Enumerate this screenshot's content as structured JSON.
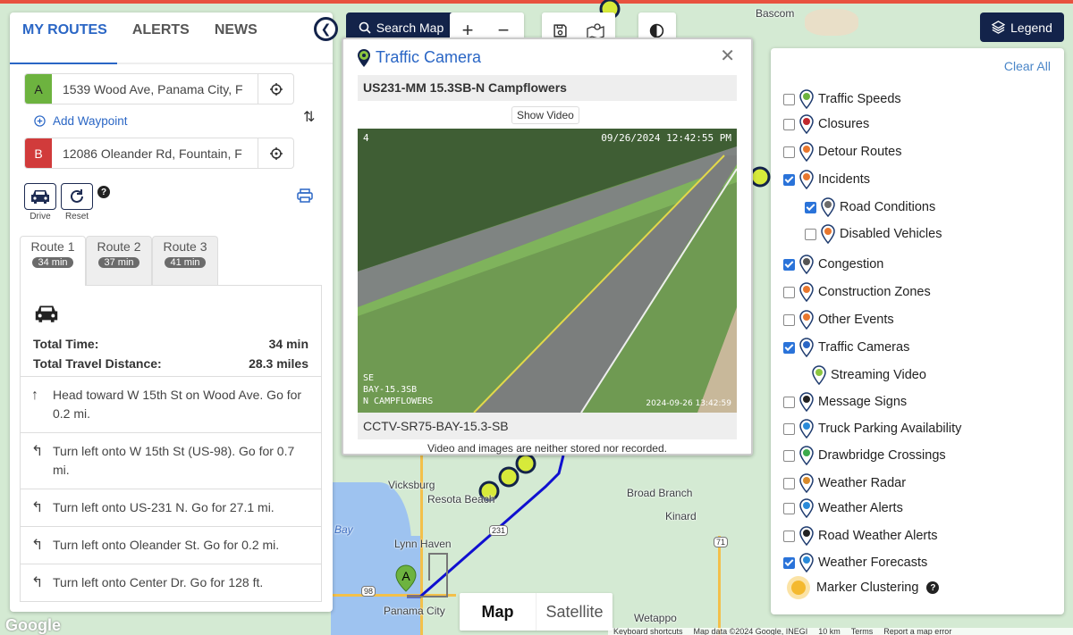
{
  "left_panel": {
    "tabs": [
      {
        "label": "MY ROUTES",
        "active": true
      },
      {
        "label": "ALERTS",
        "active": false
      },
      {
        "label": "NEWS",
        "active": false
      }
    ],
    "origin": {
      "badge": "A",
      "value": "1539 Wood Ave, Panama City, F",
      "color": "#6db33f"
    },
    "destination": {
      "badge": "B",
      "value": "12086 Oleander Rd, Fountain, F",
      "color": "#d13b3b"
    },
    "add_waypoint": "Add Waypoint",
    "drive_label": "Drive",
    "reset_label": "Reset",
    "help": "?",
    "route_tabs": [
      {
        "label": "Route 1",
        "time": "34 min",
        "active": true
      },
      {
        "label": "Route 2",
        "time": "37 min",
        "active": false
      },
      {
        "label": "Route 3",
        "time": "41 min",
        "active": false
      }
    ],
    "summary": {
      "total_time_label": "Total Time:",
      "total_time": "34 min",
      "distance_label": "Total Travel Distance:",
      "distance": "28.3 miles"
    },
    "steps": [
      {
        "icon": "arrow-up",
        "text": "Head toward W 15th St on Wood Ave. Go for 0.2 mi."
      },
      {
        "icon": "turn-left",
        "text": "Turn left onto W 15th St (US-98). Go for 0.7 mi."
      },
      {
        "icon": "turn-left",
        "text": "Turn left onto US-231 N. Go for 27.1 mi."
      },
      {
        "icon": "turn-left",
        "text": "Turn left onto Oleander St. Go for 0.2 mi."
      },
      {
        "icon": "turn-left",
        "text": "Turn left onto Center Dr. Go for 128 ft."
      }
    ]
  },
  "toolbar": {
    "search_label": "Search Map",
    "zoom_in": "+",
    "zoom_out": "−",
    "legend_label": "Legend"
  },
  "camera_popup": {
    "title": "Traffic Camera",
    "camera_name": "US231-MM 15.3SB-N Campflowers",
    "show_video": "Show Video",
    "overlay_top_left": "4",
    "overlay_timestamp": "09/26/2024 12:42:55 PM",
    "overlay_label_lines": [
      "SE",
      "BAY-15.3SB",
      "N CAMPFLOWERS"
    ],
    "overlay_bottom_right": "2024-09-26 13:42:59",
    "caption": "CCTV-SR75-BAY-15.3-SB",
    "note": "Video and images are neither stored nor recorded."
  },
  "legend": {
    "clear_all": "Clear All",
    "items": [
      {
        "label": "Traffic Speeds",
        "checked": false,
        "indent": 0
      },
      {
        "label": "Closures",
        "checked": false,
        "indent": 0
      },
      {
        "label": "Detour Routes",
        "checked": false,
        "indent": 0
      },
      {
        "label": "Incidents",
        "checked": true,
        "indent": 0
      },
      {
        "label": "Road Conditions",
        "checked": true,
        "indent": 1
      },
      {
        "label": "Disabled Vehicles",
        "checked": false,
        "indent": 1
      },
      {
        "label": "Congestion",
        "checked": true,
        "indent": 0
      },
      {
        "label": "Construction Zones",
        "checked": false,
        "indent": 0
      },
      {
        "label": "Other Events",
        "checked": false,
        "indent": 0
      },
      {
        "label": "Traffic Cameras",
        "checked": true,
        "indent": 0
      },
      {
        "label": "Streaming Video",
        "checked": null,
        "indent": 1
      },
      {
        "label": "Message Signs",
        "checked": false,
        "indent": 0
      },
      {
        "label": "Truck Parking Availability",
        "checked": false,
        "indent": 0
      },
      {
        "label": "Drawbridge Crossings",
        "checked": false,
        "indent": 0
      },
      {
        "label": "Weather Radar",
        "checked": false,
        "indent": 0
      },
      {
        "label": "Weather Alerts",
        "checked": false,
        "indent": 0
      },
      {
        "label": "Road Weather Alerts",
        "checked": false,
        "indent": 0
      },
      {
        "label": "Weather Forecasts",
        "checked": true,
        "indent": 0
      }
    ],
    "marker_clustering": "Marker Clustering"
  },
  "map": {
    "labels": [
      "Bascom",
      "Vicksburg",
      "Resota Beach",
      "Lynn Haven",
      "Panama City",
      "Broad Branch",
      "Kinard",
      "Wetappo",
      "Bay"
    ],
    "shields": [
      "98",
      "231",
      "71"
    ],
    "type_buttons": [
      {
        "label": "Map",
        "active": true
      },
      {
        "label": "Satellite",
        "active": false
      }
    ],
    "footer": [
      "Keyboard shortcuts",
      "Map data ©2024 Google, INEGI",
      "10 km",
      "Terms",
      "Report a map error"
    ],
    "google": "Google",
    "route_color": "#1010d0"
  }
}
